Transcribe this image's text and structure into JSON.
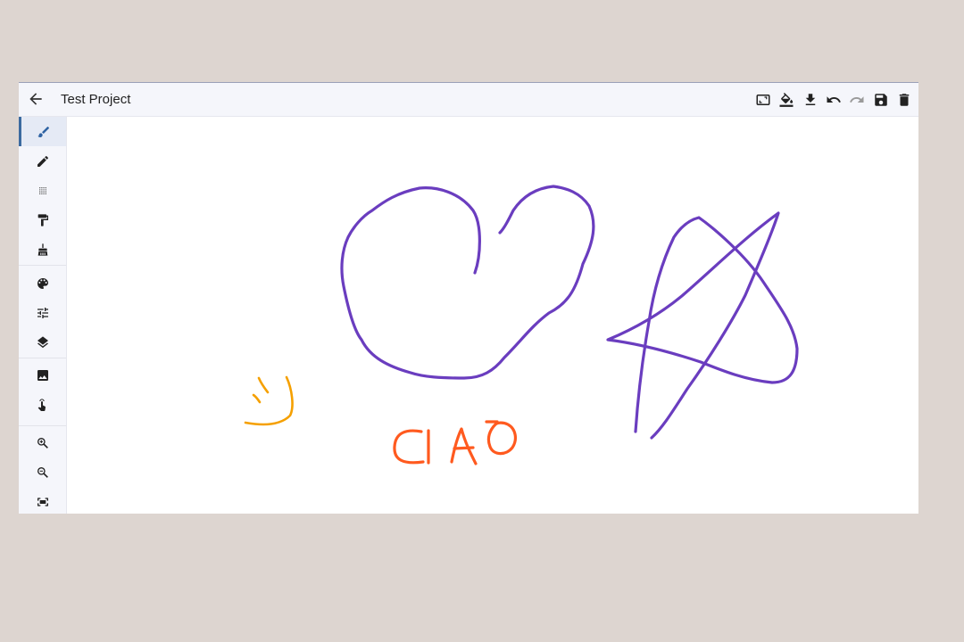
{
  "header": {
    "back_icon": "arrow-left-icon",
    "title": "Test Project",
    "actions": [
      {
        "name": "resize-canvas-button",
        "icon": "aspect-ratio-icon"
      },
      {
        "name": "fill-color-button",
        "icon": "paint-bucket-icon"
      },
      {
        "name": "download-button",
        "icon": "download-icon"
      },
      {
        "name": "undo-button",
        "icon": "undo-icon"
      },
      {
        "name": "redo-button",
        "icon": "redo-icon",
        "disabled": true
      },
      {
        "name": "save-button",
        "icon": "save-icon"
      },
      {
        "name": "delete-button",
        "icon": "trash-icon"
      }
    ]
  },
  "sidebar": {
    "tools": [
      {
        "name": "brush-tool",
        "icon": "brush-icon",
        "active": true
      },
      {
        "name": "pencil-tool",
        "icon": "pencil-icon"
      },
      {
        "name": "spray-tool",
        "icon": "spray-dots-icon"
      },
      {
        "name": "roller-tool",
        "icon": "paint-roller-icon"
      },
      {
        "name": "broom-tool",
        "icon": "broom-icon"
      },
      {
        "name": "palette-tool",
        "icon": "palette-icon"
      },
      {
        "name": "adjustments-tool",
        "icon": "sliders-icon"
      },
      {
        "name": "layers-tool",
        "icon": "layers-icon"
      },
      {
        "name": "image-tool",
        "icon": "image-icon"
      },
      {
        "name": "pan-tool",
        "icon": "hand-pointer-icon"
      },
      {
        "name": "zoom-in-tool",
        "icon": "zoom-in-icon"
      },
      {
        "name": "zoom-out-tool",
        "icon": "zoom-out-icon"
      },
      {
        "name": "fit-screen-tool",
        "icon": "fit-screen-icon"
      }
    ]
  },
  "colors": {
    "stroke_purple": "#6a3dbf",
    "stroke_orange": "#ff5a1f",
    "stroke_amber": "#f5a000",
    "accent": "#3b6aa0",
    "background": "#ddd5d0"
  }
}
